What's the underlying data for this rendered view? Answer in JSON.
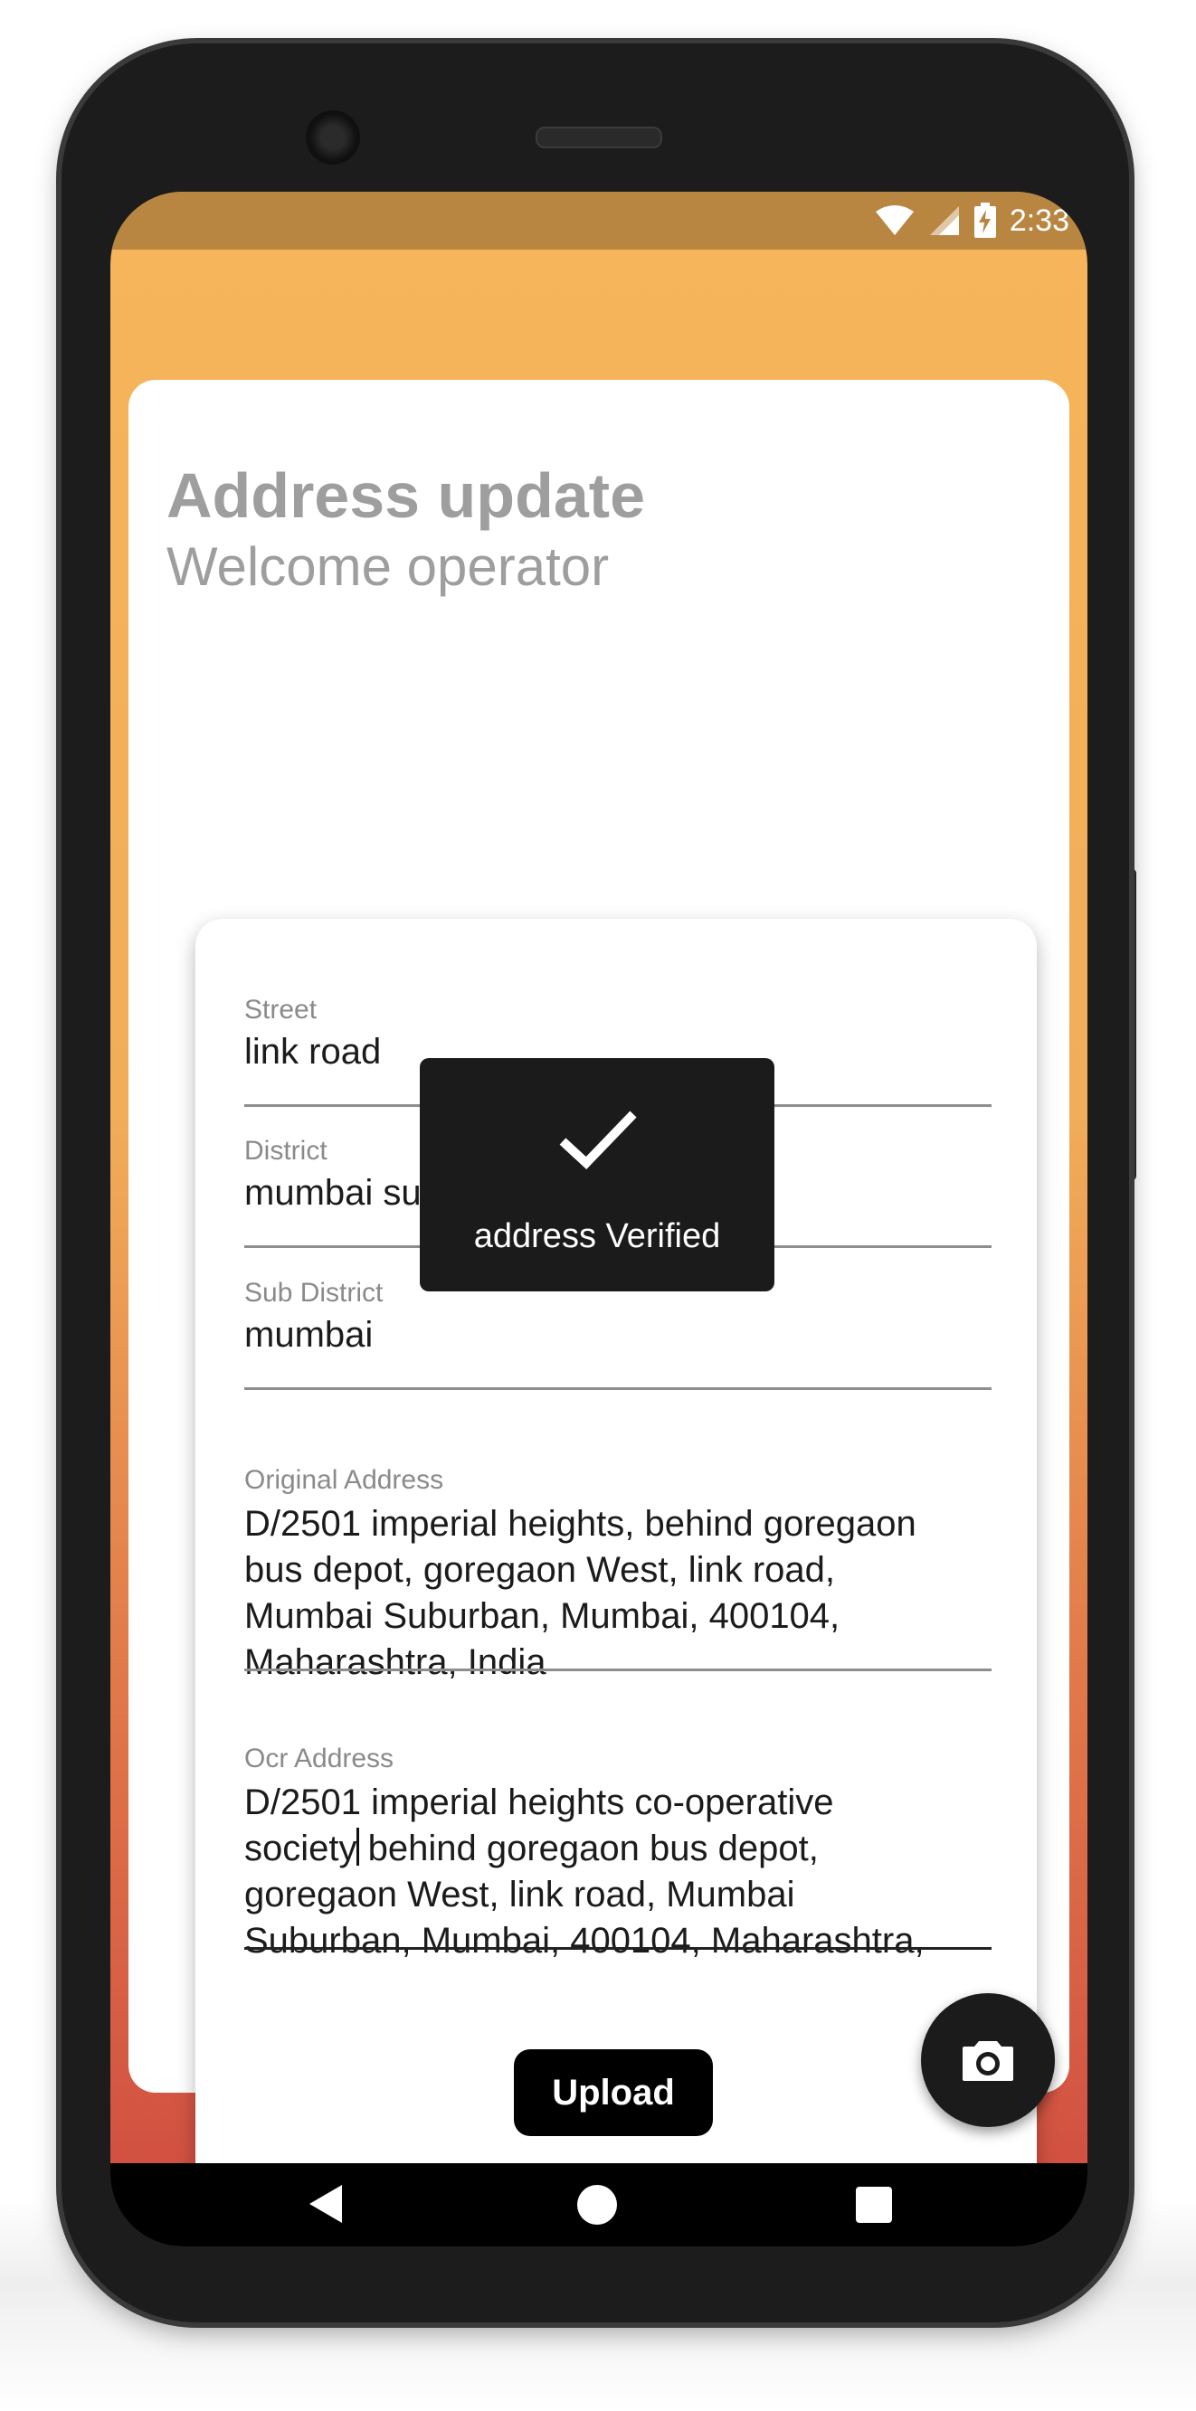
{
  "status_bar": {
    "time": "2:33",
    "icons": [
      "wifi-icon",
      "signal-icon",
      "battery-charging-icon"
    ]
  },
  "header": {
    "title": "Address update",
    "subtitle": "Welcome operator"
  },
  "form": {
    "fields": [
      {
        "label": "Street",
        "value": "link road"
      },
      {
        "label": "District",
        "value": "mumbai suburban"
      },
      {
        "label": "Sub District",
        "value": "mumbai"
      },
      {
        "label": "Original Address",
        "lines": [
          "D/2501 imperial heights, behind goregaon",
          "bus depot, goregaon West, link road,",
          "Mumbai Suburban, Mumbai, 400104,",
          "Maharashtra, India"
        ]
      },
      {
        "label": "Ocr Address",
        "lines": [
          "D/2501 imperial heights co-operative",
          "society",
          " behind goregaon bus depot,",
          "goregaon West, link road, Mumbai",
          "Suburban, Mumbai, 400104, Maharashtra,"
        ]
      }
    ],
    "upload_label": "Upload"
  },
  "toast": {
    "icon": "checkmark-icon",
    "message": "address Verified"
  },
  "fab": {
    "icon": "camera-icon"
  },
  "nav_bar": {
    "icons": [
      "back-icon",
      "home-icon",
      "recents-icon"
    ]
  },
  "colors": {
    "header_start": "#f6b55b",
    "header_end": "#cf4a40",
    "status_bar": "#b98642",
    "title_gray": "#9e9e9e",
    "button_black": "#000000",
    "toast_bg": "#1b1b1b"
  }
}
